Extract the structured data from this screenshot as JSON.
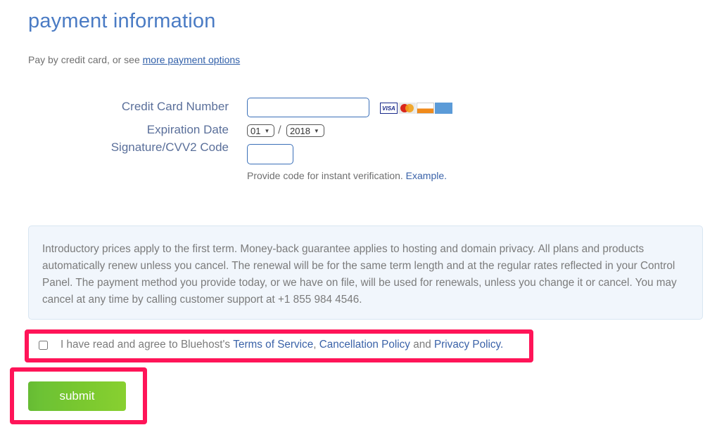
{
  "header": {
    "title": "payment information",
    "subtitle_prefix": "Pay by credit card, or see ",
    "subtitle_link": "more payment options"
  },
  "form": {
    "card_number": {
      "label": "Credit Card Number",
      "value": "",
      "placeholder": ""
    },
    "accepted_cards": [
      "VISA",
      "MasterCard",
      "DISCOVER",
      "American Express"
    ],
    "expiration": {
      "label": "Expiration Date",
      "month": "01",
      "separator": "/",
      "year": "2018"
    },
    "cvv": {
      "label": "Signature/CVV2 Code",
      "value": "",
      "hint": "Provide code for instant verification. ",
      "hint_link": "Example."
    }
  },
  "notice": {
    "text": "Introductory prices apply to the first term. Money-back guarantee applies to hosting and domain privacy. All plans and products automatically renew unless you cancel. The renewal will be for the same term length and at the regular rates reflected in your Control Panel. The payment method you provide today, or we have on file, will be used for renewals, unless you change it or cancel. You may cancel at any time by calling customer support at +1 855 984 4546."
  },
  "agreement": {
    "checked": false,
    "prefix": "I have read and agree to Bluehost's ",
    "terms_link": "Terms of Service",
    "comma": ", ",
    "cancellation_link": "Cancellation Policy",
    "and": " and ",
    "privacy_link": "Privacy Policy."
  },
  "actions": {
    "submit_label": "submit"
  },
  "colors": {
    "title": "#4a7bc4",
    "link": "#3a62a8",
    "highlight": "#ff1458",
    "submit": "#7ac82f",
    "notice_bg": "#f1f6fc"
  }
}
